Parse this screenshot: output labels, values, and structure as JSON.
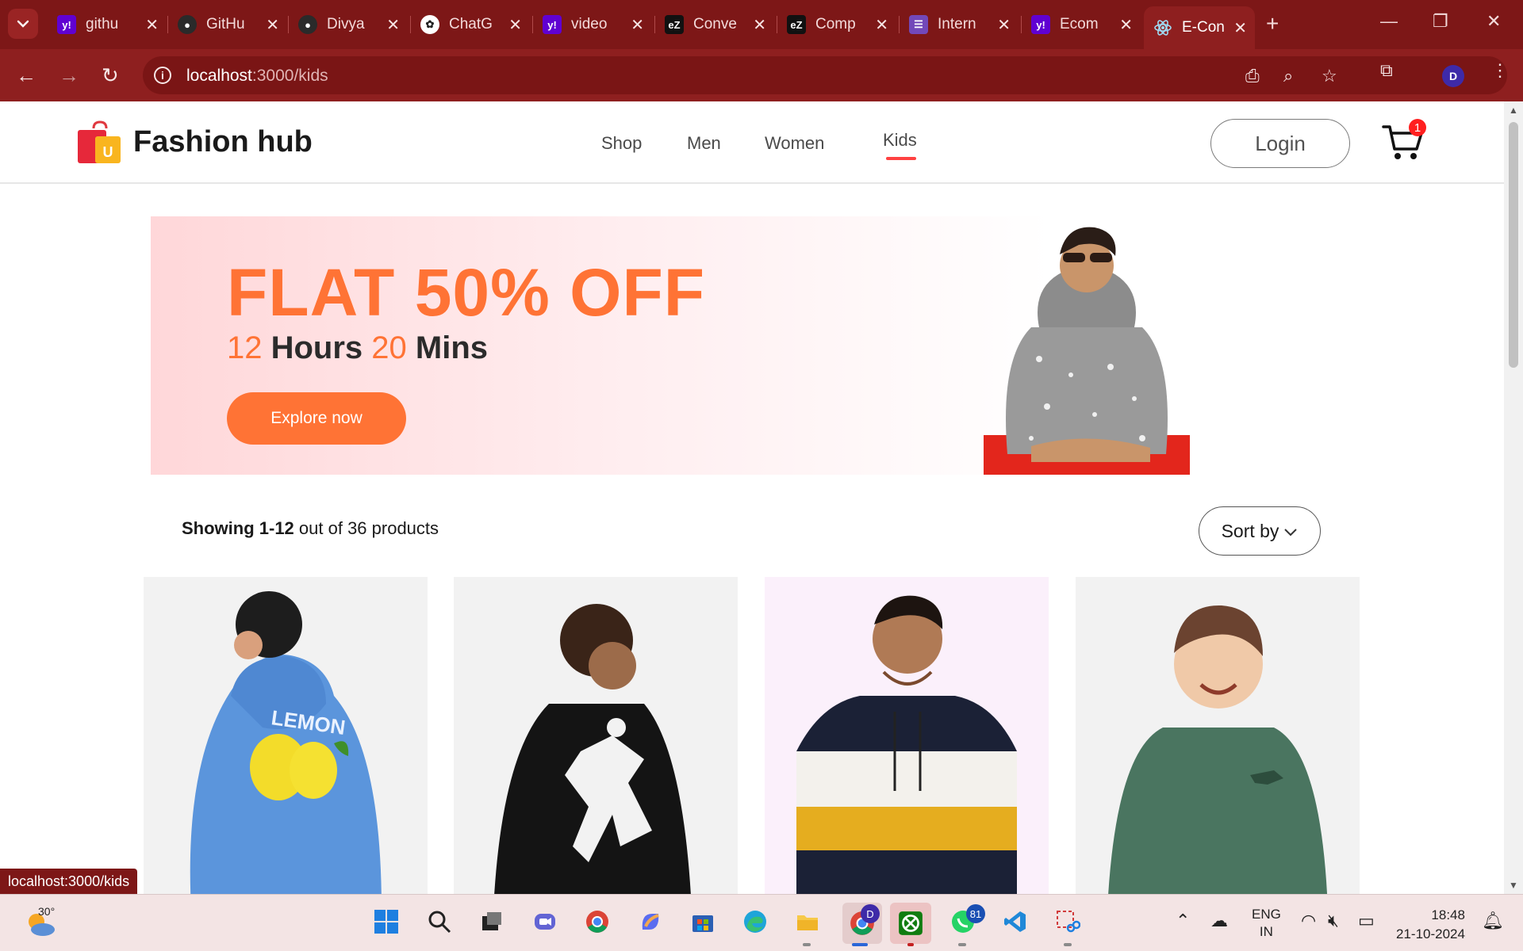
{
  "browser": {
    "tabs": [
      {
        "title": "githu",
        "favicon": "yahoo-icon"
      },
      {
        "title": "GitHu",
        "favicon": "github-icon"
      },
      {
        "title": "Divya",
        "favicon": "github-icon"
      },
      {
        "title": "ChatG",
        "favicon": "chatgpt-icon"
      },
      {
        "title": "video",
        "favicon": "yahoo-icon"
      },
      {
        "title": "Conve",
        "favicon": "ez-icon"
      },
      {
        "title": "Comp",
        "favicon": "ez-icon"
      },
      {
        "title": "Intern",
        "favicon": "forms-icon"
      },
      {
        "title": "Ecom",
        "favicon": "yahoo-icon"
      },
      {
        "title": "E-Con",
        "favicon": "react-icon",
        "active": true
      }
    ],
    "url_host": "localhost",
    "url_path": ":3000/kids",
    "profile_initial": "D",
    "status_url": "localhost:3000/kids"
  },
  "site": {
    "logo_text": "Fashion hub",
    "logo_letter": "U",
    "nav": [
      "Shop",
      "Men",
      "Women",
      "Kids"
    ],
    "active_nav": "Kids",
    "login_label": "Login",
    "cart_count": "1"
  },
  "banner": {
    "headline": "FLAT 50% OFF",
    "hours_num": "12",
    "hours_label": " Hours ",
    "mins_num": "20",
    "mins_label": " Mins",
    "cta": "Explore now"
  },
  "listing": {
    "showing_range": "Showing 1-12",
    "showing_rest": " out of 36 products",
    "sort_label": "Sort by"
  },
  "products": [
    {
      "name": "blue-lemon-hoodie"
    },
    {
      "name": "black-football-hoodie"
    },
    {
      "name": "navy-white-yellow-hoodie"
    },
    {
      "name": "green-dino-sweatshirt"
    }
  ],
  "taskbar": {
    "weather_temp": "30°",
    "lang_line1": "ENG",
    "lang_line2": "IN",
    "time": "18:48",
    "date": "21-10-2024",
    "badge_chrome": "D",
    "badge_whatsapp": "81"
  },
  "colors": {
    "chrome_dark": "#7d1717",
    "chrome": "#8e1f1f",
    "accent_orange": "#ff7335",
    "nav_active": "#ff4141"
  }
}
